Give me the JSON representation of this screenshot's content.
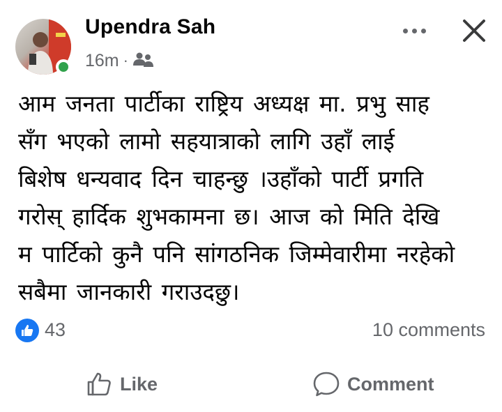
{
  "post": {
    "author": "Upendra Sah",
    "time": "16m",
    "separator": "·",
    "audience_icon": "friends-icon",
    "text_lines": [
      "आम जनता पार्टीका  राष्ट्रिय  अध्यक्ष मा. प्रभु  साह",
      "सँग भएको  लामो सहयात्राको लागि   उहाँ  लाई",
      "बिशेष  धन्यवाद  दिन चाहन्छु ।उहाँको  पार्टी प्रगति",
      "गरोस्  हार्दिक  शुभकामना  छ। आज को मिति देखि",
      "म पार्टिको कुनै पनि सांगठनिक जिम्मेवारीमा नरहेको",
      "सबैमा जानकारी गराउदछु।"
    ]
  },
  "reactions": {
    "like_count": "43",
    "comments": "10 comments"
  },
  "actions": {
    "like_label": "Like",
    "comment_label": "Comment"
  },
  "colors": {
    "brand_blue": "#1877f2",
    "online_green": "#31a24c",
    "secondary_text": "#65676b"
  }
}
